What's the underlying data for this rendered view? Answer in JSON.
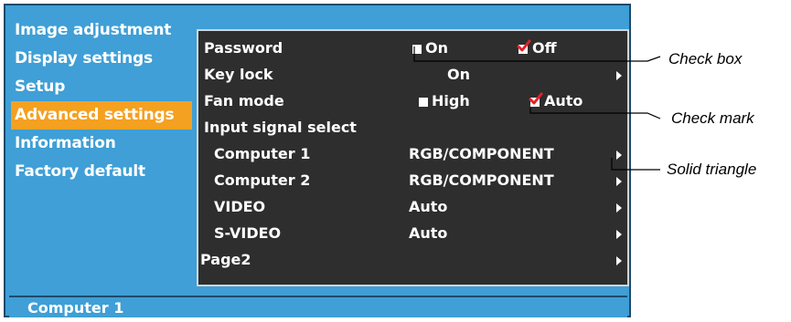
{
  "menu": {
    "items": [
      {
        "label": "Image adjustment",
        "active": false
      },
      {
        "label": "Display settings",
        "active": false
      },
      {
        "label": "Setup",
        "active": false
      },
      {
        "label": "Advanced settings",
        "active": true
      },
      {
        "label": "Information",
        "active": false
      },
      {
        "label": "Factory default",
        "active": false
      }
    ]
  },
  "panel": {
    "password": {
      "label": "Password",
      "on": "On",
      "off": "Off",
      "selected": "Off"
    },
    "keylock": {
      "label": "Key lock",
      "value": "On"
    },
    "fanmode": {
      "label": "Fan mode",
      "high": "High",
      "auto": "Auto",
      "selected": "Auto"
    },
    "input_signal": {
      "label": "Input signal select"
    },
    "computer1": {
      "label": "Computer 1",
      "value": "RGB/COMPONENT"
    },
    "computer2": {
      "label": "Computer 2",
      "value": "RGB/COMPONENT"
    },
    "video": {
      "label": "VIDEO",
      "value": "Auto"
    },
    "svideo": {
      "label": "S-VIDEO",
      "value": "Auto"
    },
    "page2": {
      "label": "Page2"
    }
  },
  "status": {
    "text": "Computer 1"
  },
  "callouts": {
    "checkbox": "Check box",
    "checkmark": "Check mark",
    "triangle": "Solid triangle"
  },
  "colors": {
    "osd_bg": "#3f9fd6",
    "panel_bg": "#2e2e2e",
    "active_item": "#f4a020",
    "check_red": "#e8202a"
  }
}
